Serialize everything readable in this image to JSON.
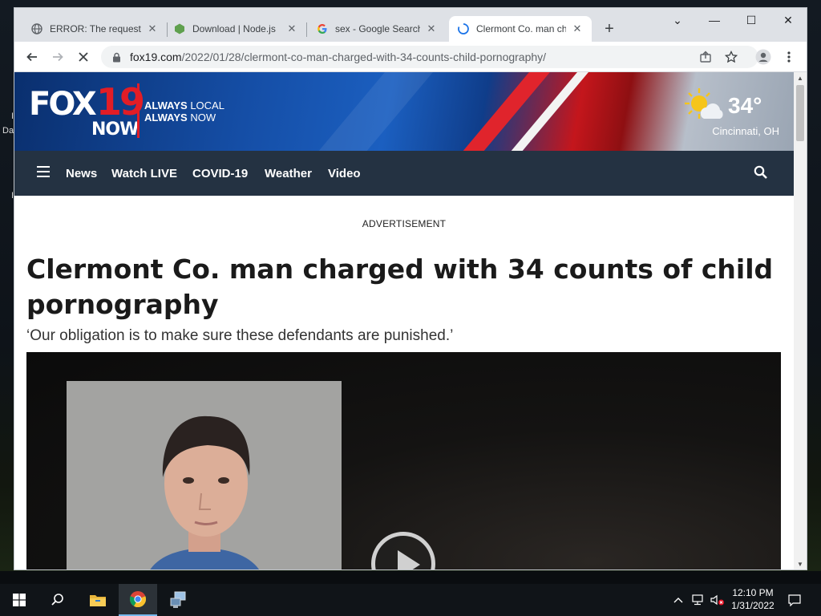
{
  "desktop": {
    "icon_label_fragments": [
      "I",
      "Da",
      "I"
    ]
  },
  "window": {
    "tabs": [
      {
        "title": "ERROR: The requested",
        "icon": "globe-icon"
      },
      {
        "title": "Download | Node.js",
        "icon": "nodejs-icon"
      },
      {
        "title": "sex - Google Search",
        "icon": "google-icon"
      },
      {
        "title": "Clermont Co. man charged",
        "icon": "loading-spinner-icon",
        "active": true
      }
    ],
    "new_tab_label": "+",
    "controls": {
      "tab_search": "⌄",
      "minimize": "—",
      "maximize": "☐",
      "close": "✕"
    }
  },
  "toolbar": {
    "url_host": "fox19.com",
    "url_path": "/2022/01/28/clermont-co-man-charged-with-34-counts-child-pornography/",
    "loading": true
  },
  "site": {
    "logo": {
      "fox": "FOX",
      "number": "19",
      "now": "NOW"
    },
    "tagline": {
      "line1_a": "ALWAYS",
      "line1_b": "LOCAL",
      "line2_a": "ALWAYS",
      "line2_b": "NOW"
    },
    "weather": {
      "temp": "34°",
      "city": "Cincinnati, OH",
      "icon": "partly-sunny-icon"
    },
    "nav": [
      "News",
      "Watch LIVE",
      "COVID-19",
      "Weather",
      "Video"
    ],
    "colors": {
      "nav_bg": "#243242",
      "brand_red": "#e21d26",
      "brand_blue": "#1b5fc0"
    }
  },
  "article": {
    "ad_label": "ADVERTISEMENT",
    "headline": "Clermont Co. man charged with 34 counts of child pornography",
    "subhead": "‘Our obligation is to make sure these defendants are punished.’"
  },
  "taskbar": {
    "clock_time": "12:10 PM",
    "clock_date": "1/31/2022",
    "pinned": [
      "start-icon",
      "search-icon",
      "file-explorer-icon",
      "chrome-icon",
      "network-app-icon"
    ],
    "tray": [
      "chevron-up-icon",
      "network-icon",
      "volume-muted-icon",
      "notifications-icon"
    ]
  }
}
